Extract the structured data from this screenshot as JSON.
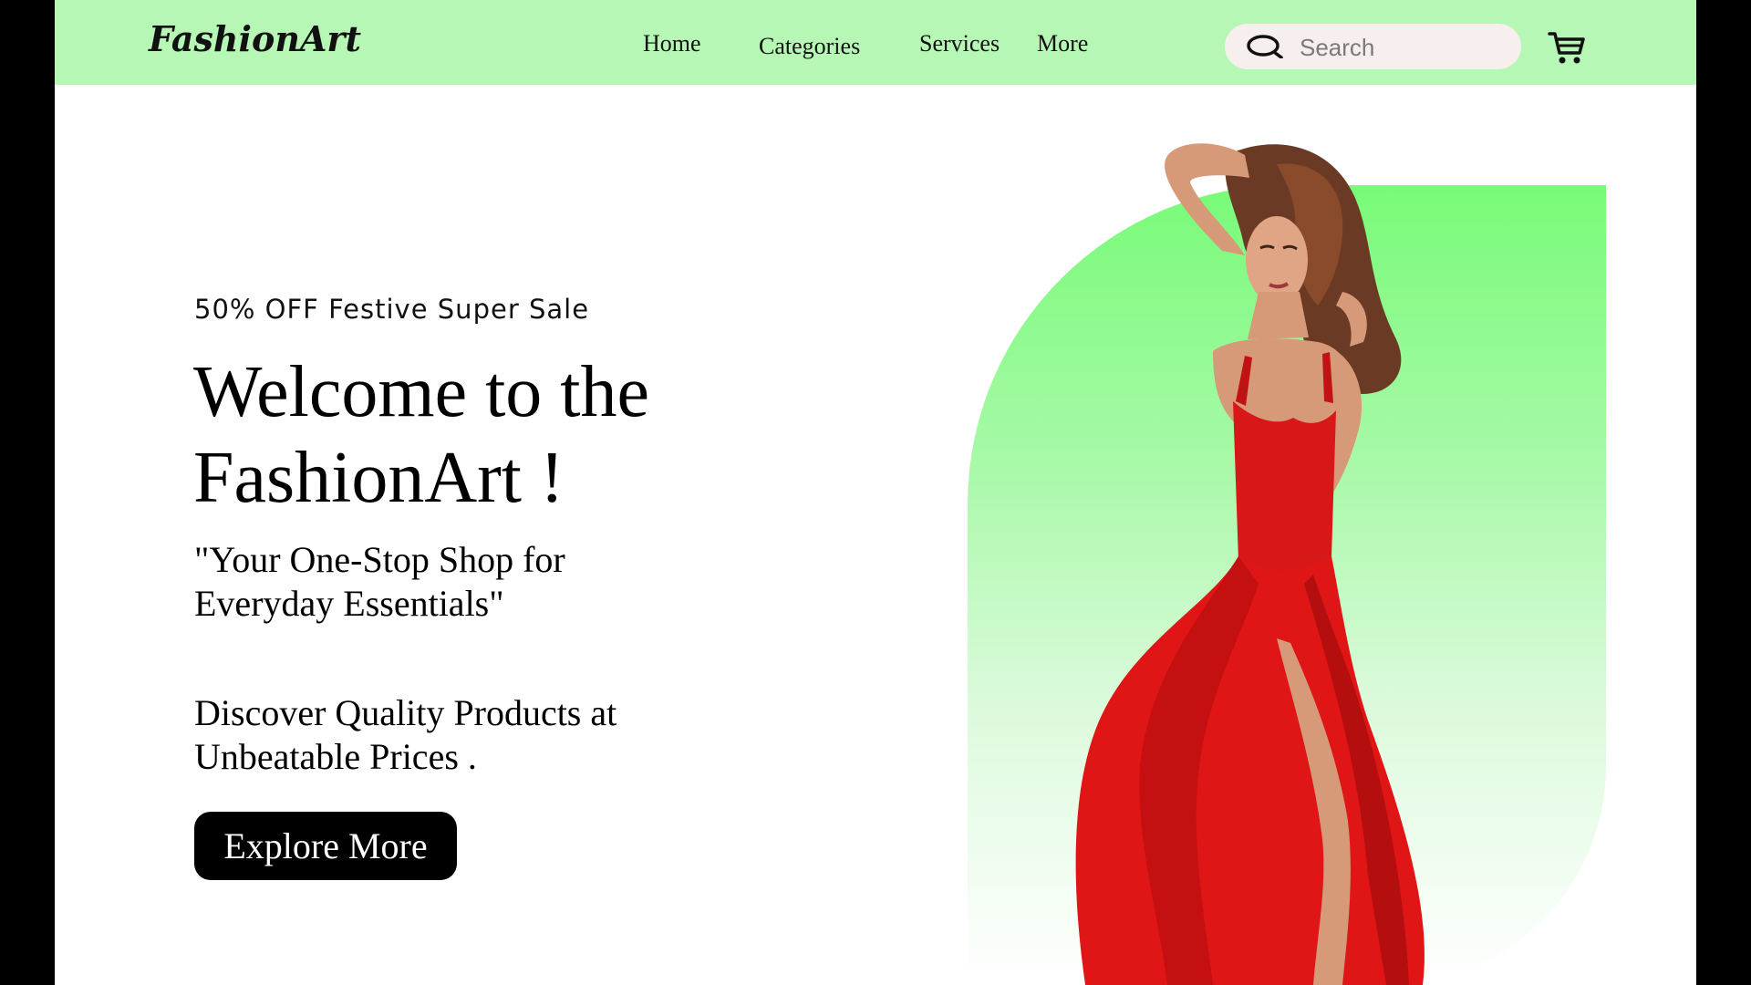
{
  "header": {
    "logo": "FashionArt",
    "nav": [
      {
        "label": "Home"
      },
      {
        "label": "Categories"
      },
      {
        "label": "Services"
      },
      {
        "label": "More"
      }
    ],
    "search": {
      "placeholder": "Search",
      "icon": "search-icon"
    },
    "cart": {
      "icon": "cart-icon"
    }
  },
  "hero": {
    "promo": "50% OFF Festive Super Sale",
    "headline_line1": "Welcome to the",
    "headline_line2": "FashionArt !",
    "tagline": "\"Your One-Stop Shop for Everyday Essentials\"",
    "subtext": "Discover Quality Products at Unbeatable Prices .",
    "cta_label": "Explore More",
    "image": "model-in-red-gown"
  },
  "colors": {
    "header_bg": "#b6f7b6",
    "accent_green": "#78fb78",
    "button_bg": "#000000",
    "dress_red": "#e01515"
  }
}
